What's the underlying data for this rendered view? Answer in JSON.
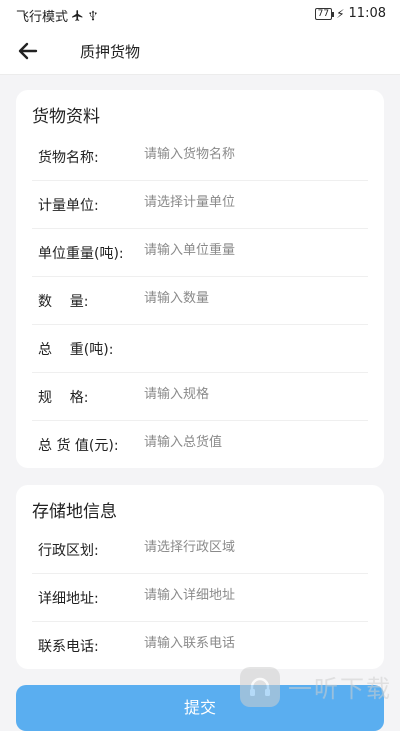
{
  "status_bar": {
    "mode_text": "飞行模式",
    "airplane_icon": "airplane-icon",
    "usb_icon": "usb-icon",
    "battery_level": "77",
    "time": "11:08"
  },
  "header": {
    "back_icon": "arrow-left-icon",
    "title": "质押货物"
  },
  "goods_section": {
    "title": "货物资料",
    "fields": [
      {
        "label": "货物名称:",
        "placeholder": "请输入货物名称"
      },
      {
        "label": "计量单位:",
        "placeholder": "请选择计量单位"
      },
      {
        "label": "单位重量(吨):",
        "placeholder": "请输入单位重量"
      },
      {
        "label": "数    量:",
        "placeholder": "请输入数量"
      },
      {
        "label": "总    重(吨):",
        "placeholder": ""
      },
      {
        "label": "规    格:",
        "placeholder": "请输入规格"
      },
      {
        "label": "总 货 值(元):",
        "placeholder": "请输入总货值"
      }
    ]
  },
  "storage_section": {
    "title": "存储地信息",
    "fields": [
      {
        "label": "行政区划:",
        "placeholder": "请选择行政区域"
      },
      {
        "label": "详细地址:",
        "placeholder": "请输入详细地址"
      },
      {
        "label": "联系电话:",
        "placeholder": "请输入联系电话"
      }
    ]
  },
  "submit_label": "提交",
  "watermark": {
    "text": "一听下载"
  },
  "colors": {
    "accent": "#5aaef0",
    "background": "#f4f4f6",
    "card": "#ffffff"
  }
}
